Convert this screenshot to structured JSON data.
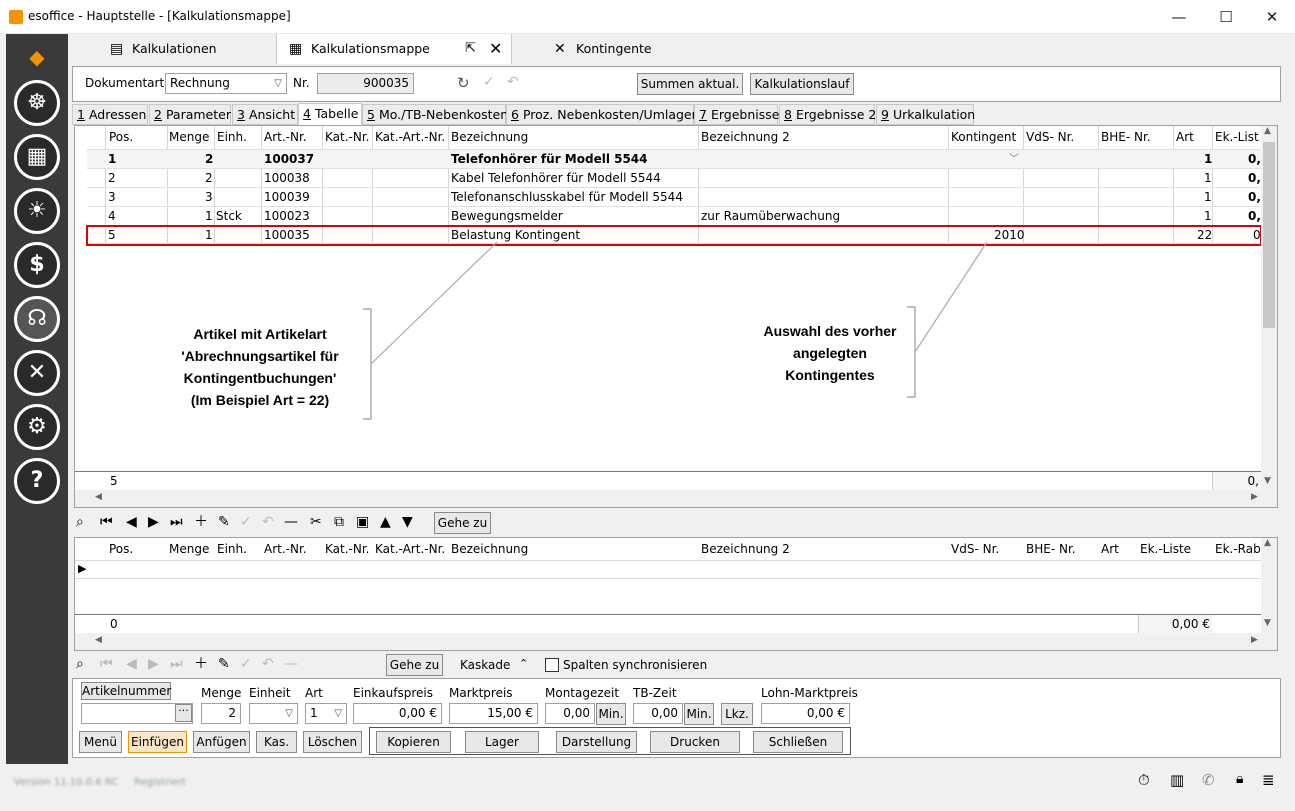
{
  "window": {
    "title": "esoffice - Hauptstelle - [Kalkulationsmappe]",
    "minimize": "—",
    "maximize": "☐",
    "close": "✕"
  },
  "main_tabs": [
    {
      "label": "Kalkulationen",
      "icon": "document-stack-icon"
    },
    {
      "label": "Kalkulationsmappe",
      "icon": "calculator-icon"
    },
    {
      "label": "Kontingente",
      "icon": "tools-icon"
    }
  ],
  "header": {
    "dokumentart_label": "Dokumentart",
    "dokumentart_value": "Rechnung",
    "nr_label": "Nr.",
    "nr_value": "900035",
    "summen_button": "Summen aktual.",
    "kalkulationslauf_button": "Kalkulationslauf"
  },
  "sub_tabs": [
    {
      "key": "1",
      "label": "Adressen"
    },
    {
      "key": "2",
      "label": "Parameter"
    },
    {
      "key": "3",
      "label": "Ansicht"
    },
    {
      "key": "4",
      "label": "Tabelle"
    },
    {
      "key": "5",
      "label": "Mo./TB-Nebenkosten"
    },
    {
      "key": "6",
      "label": "Proz. Nebenkosten/Umlagen"
    },
    {
      "key": "7",
      "label": "Ergebnisse"
    },
    {
      "key": "8",
      "label": "Ergebnisse 2"
    },
    {
      "key": "9",
      "label": "Urkalkulation"
    }
  ],
  "grid": {
    "columns": [
      "Pos.",
      "Menge",
      "Einh.",
      "Art.-Nr.",
      "Kat.-Nr.",
      "Kat.-Art.-Nr.",
      "Bezeichnung",
      "Bezeichnung 2",
      "Kontingent",
      "VdS- Nr.",
      "BHE- Nr.",
      "Art",
      "Ek.-List"
    ],
    "rows": [
      {
        "pos": "1",
        "menge": "2",
        "einh": "",
        "artnr": "100037",
        "bez": "Telefonhörer für Modell 5544",
        "bez2": "",
        "kontingent": "",
        "art": "1",
        "ek": "0,"
      },
      {
        "pos": "2",
        "menge": "2",
        "einh": "",
        "artnr": "100038",
        "bez": "Kabel Telefonhörer für Modell 5544",
        "bez2": "",
        "kontingent": "",
        "art": "1",
        "ek": "0,"
      },
      {
        "pos": "3",
        "menge": "3",
        "einh": "",
        "artnr": "100039",
        "bez": "Telefonanschlusskabel für Modell 5544",
        "bez2": "",
        "kontingent": "",
        "art": "1",
        "ek": "0,"
      },
      {
        "pos": "4",
        "menge": "1",
        "einh": "Stck",
        "artnr": "100023",
        "bez": "Bewegungsmelder",
        "bez2": "zur Raumüberwachung",
        "kontingent": "",
        "art": "1",
        "ek": "0,"
      },
      {
        "pos": "5",
        "menge": "1",
        "einh": "",
        "artnr": "100035",
        "bez": "Belastung Kontingent",
        "bez2": "",
        "kontingent": "2010",
        "art": "22",
        "ek": "0"
      }
    ],
    "footer_count": "5",
    "footer_sum": "0,"
  },
  "annotations": {
    "left": [
      "Artikel mit Artikelart",
      "'Abrechnungsartikel für",
      "Kontingentbuchungen'",
      "(Im Beispiel Art = 22)"
    ],
    "right": [
      "Auswahl des vorher",
      "angelegten",
      "Kontingentes"
    ]
  },
  "toolbar1": {
    "gehe_zu": "Gehe zu"
  },
  "grid2": {
    "columns": [
      "Pos.",
      "Menge",
      "Einh.",
      "Art.-Nr.",
      "Kat.-Nr.",
      "Kat.-Art.-Nr.",
      "Bezeichnung",
      "Bezeichnung 2",
      "VdS- Nr.",
      "BHE- Nr.",
      "Art",
      "Ek.-Liste",
      "Ek.-Rab"
    ],
    "footer_count": "0",
    "footer_sum": "0,00 €"
  },
  "toolbar2": {
    "gehe_zu": "Gehe zu",
    "kaskade": "Kaskade",
    "spalten_sync": "Spalten synchronisieren"
  },
  "bottom": {
    "artikelnummer_button": "Artikelnummer",
    "menge_label": "Menge",
    "menge_value": "2",
    "einheit_label": "Einheit",
    "art_label": "Art",
    "art_value": "1",
    "einkaufspreis_label": "Einkaufspreis",
    "einkaufspreis_value": "0,00 €",
    "marktpreis_label": "Marktpreis",
    "marktpreis_value": "15,00 €",
    "montagezeit_label": "Montagezeit",
    "montagezeit_value": "0,00",
    "min_button": "Min.",
    "tbzeit_label": "TB-Zeit",
    "tbzeit_value": "0,00",
    "min2_button": "Min.",
    "lkz_button": "Lkz.",
    "lohn_label": "Lohn-Marktpreis",
    "lohn_value": "0,00 €",
    "buttons": [
      "Menü",
      "Einfügen",
      "Anfügen",
      "Kas.",
      "Löschen"
    ],
    "buttons2": [
      "Kopieren",
      "Lager",
      "Darstellung",
      "Drucken",
      "Schließen"
    ]
  },
  "status": {
    "version": "Version 11.10.0.6 RC",
    "registered": "Registriert"
  },
  "colors": {
    "highlight": "#e00000",
    "accent": "#f29400",
    "sidebar": "#3a3a3a"
  }
}
